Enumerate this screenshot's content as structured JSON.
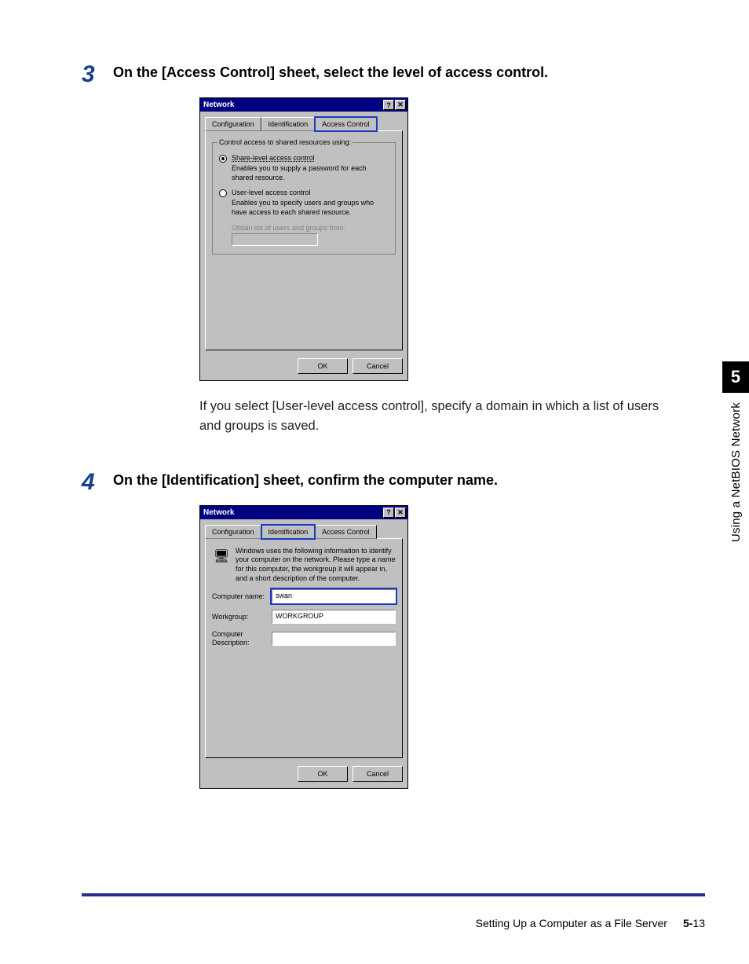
{
  "steps": {
    "s3": {
      "num": "3",
      "text": "On the [Access Control] sheet, select the level of access control."
    },
    "s4": {
      "num": "4",
      "text": "On the [Identification] sheet, confirm the computer name."
    }
  },
  "note_after_s3": "If you select [User-level access control], specify a domain in which a list of users and groups is saved.",
  "dialog1": {
    "title": "Network",
    "help_glyph": "?",
    "close_glyph": "✕",
    "tabs": {
      "config": "Configuration",
      "ident": "Identification",
      "access": "Access Control"
    },
    "group_label": "Control access to shared resources using:",
    "share_label": "Share-level access control",
    "share_desc": "Enables you to supply a password for each shared resource.",
    "user_label": "User-level access control",
    "user_desc": "Enables you to specify users and groups who have access to each shared resource.",
    "obtain_label": "Obtain list of users and groups from:",
    "ok": "OK",
    "cancel": "Cancel"
  },
  "dialog2": {
    "title": "Network",
    "help_glyph": "?",
    "close_glyph": "✕",
    "tabs": {
      "config": "Configuration",
      "ident": "Identification",
      "access": "Access Control"
    },
    "desc": "Windows uses the following information to identify your computer on the network. Please type a name for this computer, the workgroup it will appear in, and a short description of the computer.",
    "icon_glyph": "🖥",
    "labels": {
      "computer": "Computer name:",
      "workgroup": "Workgroup:",
      "descr": "Computer Description:"
    },
    "values": {
      "computer": "swan",
      "workgroup": "WORKGROUP",
      "descr": ""
    },
    "ok": "OK",
    "cancel": "Cancel"
  },
  "side": {
    "chapter": "5",
    "label": "Using a NetBIOS Network"
  },
  "footer": {
    "section": "Setting Up a Computer as a File Server",
    "page_ch": "5-",
    "page_no": "13"
  }
}
